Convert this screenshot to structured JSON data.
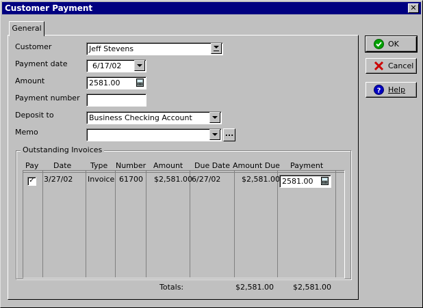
{
  "window": {
    "title": "Customer Payment",
    "close_glyph": "✕"
  },
  "tab": {
    "label": "General"
  },
  "form": {
    "customer_label": "Customer",
    "customer_value": "Jeff Stevens",
    "payment_date_label": "Payment date",
    "payment_date_value": "6/17/02",
    "amount_label": "Amount",
    "amount_value": "2581.00",
    "payment_number_label": "Payment number",
    "payment_number_value": "",
    "deposit_to_label": "Deposit to",
    "deposit_to_value": "Business Checking Account",
    "memo_label": "Memo",
    "memo_value": "",
    "memo_button": "..."
  },
  "outstanding": {
    "title": "Outstanding Invoices",
    "columns": [
      "Pay",
      "Date",
      "Type",
      "Number",
      "Amount",
      "Due Date",
      "Amount Due",
      "Payment"
    ],
    "rows": [
      {
        "pay": true,
        "pay_glyph": "✓",
        "date": "3/27/02",
        "type": "Invoice",
        "number": "61700",
        "amount": "$2,581.00",
        "due_date": "6/27/02",
        "amount_due": "$2,581.00",
        "payment": "2581.00"
      }
    ],
    "totals_label": "Totals:",
    "totals_amount_due": "$2,581.00",
    "totals_payment": "$2,581.00"
  },
  "buttons": {
    "ok": "OK",
    "cancel": "Cancel",
    "help": "Help"
  },
  "colors": {
    "titlebar": "#000080",
    "ok_icon": "#00a000",
    "cancel_icon": "#cc0000",
    "help_icon": "#0000c0"
  }
}
